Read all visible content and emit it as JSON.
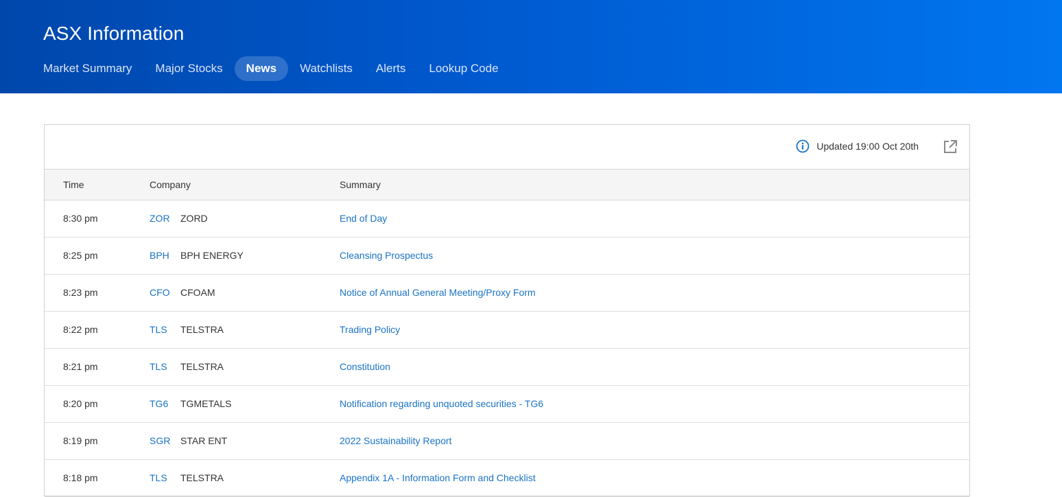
{
  "header": {
    "title": "ASX Information",
    "nav": [
      {
        "label": "Market Summary",
        "active": false
      },
      {
        "label": "Major Stocks",
        "active": false
      },
      {
        "label": "News",
        "active": true
      },
      {
        "label": "Watchlists",
        "active": false
      },
      {
        "label": "Alerts",
        "active": false
      },
      {
        "label": "Lookup Code",
        "active": false
      }
    ]
  },
  "panel": {
    "updated_text": "Updated 19:00 Oct 20th",
    "columns": {
      "time": "Time",
      "company": "Company",
      "summary": "Summary"
    },
    "rows": [
      {
        "time": "8:30 pm",
        "code": "ZOR",
        "name": "ZORD",
        "summary": "End of Day"
      },
      {
        "time": "8:25 pm",
        "code": "BPH",
        "name": "BPH ENERGY",
        "summary": "Cleansing Prospectus"
      },
      {
        "time": "8:23 pm",
        "code": "CFO",
        "name": "CFOAM",
        "summary": "Notice of Annual General Meeting/Proxy Form"
      },
      {
        "time": "8:22 pm",
        "code": "TLS",
        "name": "TELSTRA",
        "summary": "Trading Policy"
      },
      {
        "time": "8:21 pm",
        "code": "TLS",
        "name": "TELSTRA",
        "summary": "Constitution"
      },
      {
        "time": "8:20 pm",
        "code": "TG6",
        "name": "TGMETALS",
        "summary": "Notification regarding unquoted securities - TG6"
      },
      {
        "time": "8:19 pm",
        "code": "SGR",
        "name": "STAR ENT",
        "summary": "2022 Sustainability Report"
      },
      {
        "time": "8:18 pm",
        "code": "TLS",
        "name": "TELSTRA",
        "summary": "Appendix 1A - Information Form and Checklist"
      }
    ]
  },
  "colors": {
    "header_gradient_start": "#0047ab",
    "header_gradient_end": "#0076ef",
    "link": "#1a73c6"
  },
  "icons": {
    "info": "info-circle-icon",
    "external": "external-link-icon"
  }
}
